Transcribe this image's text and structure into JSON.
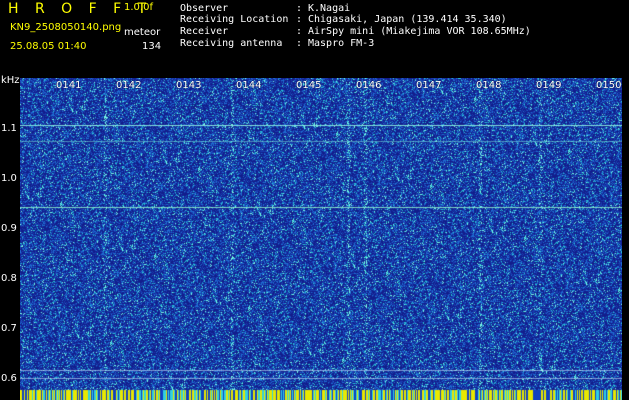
{
  "header": {
    "app_title": "H R O F F T",
    "app_version": "1.0.0f",
    "file_name": "KN9_2508050140.png",
    "mode_label": "meteor",
    "timestamp": "25.08.05 01:40",
    "count": "134"
  },
  "info": [
    {
      "label": "Observer",
      "value": "K.Nagai"
    },
    {
      "label": "Receiving Location",
      "value": "Chigasaki, Japan (139.414 35.340)"
    },
    {
      "label": "Receiver",
      "value": "AirSpy mini (Miakejima VOR 108.65MHz)"
    },
    {
      "label": "Receiving antenna",
      "value": "Maspro FM-3"
    }
  ],
  "axis": {
    "unit": "kHz",
    "y_ticks": [
      "1.1",
      "1.0",
      "0.9",
      "0.8",
      "0.7",
      "0.6"
    ],
    "y_range": [
      0.58,
      1.18
    ],
    "time_labels": [
      "0141",
      "0142",
      "0143",
      "0144",
      "0145",
      "0146",
      "0147",
      "0148",
      "0149",
      "0150"
    ]
  },
  "colors": {
    "background": "#000000",
    "spectrogram_base": "#1a2a9a",
    "title": "#ffff00",
    "signal": "#40ffff"
  }
}
